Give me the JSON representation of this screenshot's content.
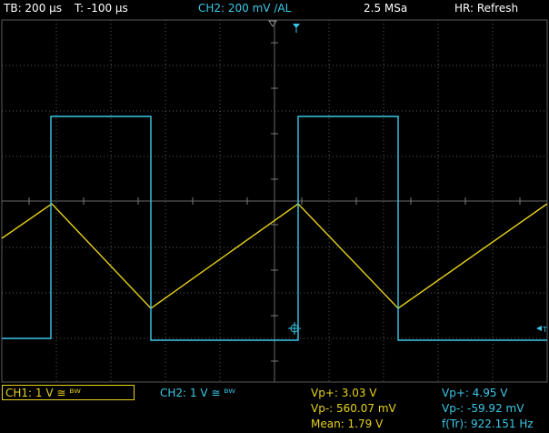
{
  "top": {
    "timebase": "TB: 200 µs",
    "trigger_time": "T: -100 µs",
    "channel": "CH2: 200 mV ∕AL",
    "sample_rate": "2.5 MSa",
    "hr_mode": "HR: Refresh"
  },
  "bottom": {
    "ch1": "CH1: 1 V ≅ ᴮᵂ",
    "ch2": "CH2: 1 V ≅ ᴮᵂ",
    "ch1_meas": [
      "Vp+: 3.03 V",
      "Vp-: 560.07 mV",
      "Mean: 1.79 V"
    ],
    "ch2_meas": [
      "Vp+: 4.95 V",
      "Vp-: -59.92 mV",
      "f(Tr): 922.151 Hz"
    ]
  },
  "colors": {
    "ch1": "#e8d21a",
    "ch2": "#3bc8e8",
    "grid": "#5a5a5a"
  },
  "icons": [
    "trigger-marker-icon",
    "trigger-position-icon",
    "ch2-level-marker-icon"
  ]
}
